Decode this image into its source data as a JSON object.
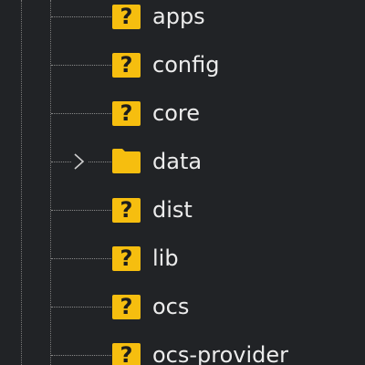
{
  "tree": {
    "items": [
      {
        "label": "apps",
        "icon": "unknown-file-icon",
        "icon_glyph": "?",
        "expandable": false
      },
      {
        "label": "config",
        "icon": "unknown-file-icon",
        "icon_glyph": "?",
        "expandable": false
      },
      {
        "label": "core",
        "icon": "unknown-file-icon",
        "icon_glyph": "?",
        "expandable": false
      },
      {
        "label": "data",
        "icon": "folder-icon",
        "icon_glyph": "",
        "expandable": true
      },
      {
        "label": "dist",
        "icon": "unknown-file-icon",
        "icon_glyph": "?",
        "expandable": false
      },
      {
        "label": "lib",
        "icon": "unknown-file-icon",
        "icon_glyph": "?",
        "expandable": false
      },
      {
        "label": "ocs",
        "icon": "unknown-file-icon",
        "icon_glyph": "?",
        "expandable": false
      },
      {
        "label": "ocs-provider",
        "icon": "unknown-file-icon",
        "icon_glyph": "?",
        "expandable": false
      }
    ]
  },
  "colors": {
    "background": "#212326",
    "icon_yellow": "#f6be0f",
    "text": "#ececec",
    "guide_line": "#7a7a7a"
  }
}
